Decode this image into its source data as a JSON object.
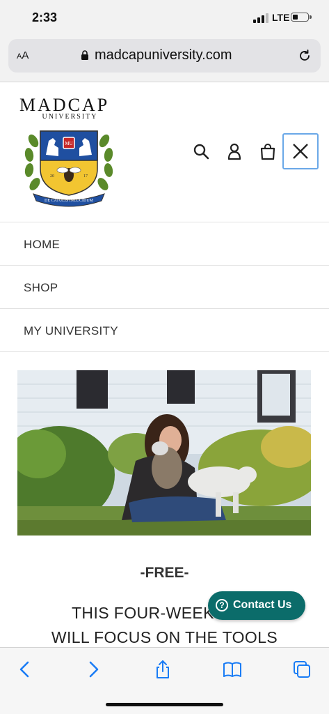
{
  "status_bar": {
    "time": "2:33",
    "network": "LTE",
    "signal_bars_active": 3,
    "signal_bars_total": 4,
    "battery_level": 0.35
  },
  "browser": {
    "text_size_label": "AA",
    "url": "madcapuniversity.com"
  },
  "site": {
    "logo_name": "MADCAP",
    "logo_subtitle": "UNIVERSITY",
    "crest_text": {
      "left_year": "20",
      "right_year": "17",
      "shield_badge": "MU",
      "motto": "DE CATULIS INLUCIDUM"
    }
  },
  "menu": {
    "items": [
      {
        "label": "HOME"
      },
      {
        "label": "SHOP"
      },
      {
        "label": "MY UNIVERSITY"
      }
    ]
  },
  "promo": {
    "free_label": "-FREE-",
    "headline_line1": "THIS FOUR-WEEK VIDE",
    "headline_line2": "WILL FOCUS ON THE TOOLS"
  },
  "contact_button": {
    "label": "Contact Us",
    "icon_glyph": "?"
  },
  "icons": [
    "search-icon",
    "account-icon",
    "cart-icon",
    "close-icon",
    "lock-icon",
    "reload-icon",
    "back-icon",
    "forward-icon",
    "share-icon",
    "bookmarks-icon",
    "tabs-icon"
  ],
  "colors": {
    "accent_blue": "#1a7cf5",
    "contact_teal": "#0b6c6a",
    "crest_blue": "#1f4fa0",
    "crest_yellow": "#f2c531",
    "laurel_green": "#5a8a2a"
  }
}
